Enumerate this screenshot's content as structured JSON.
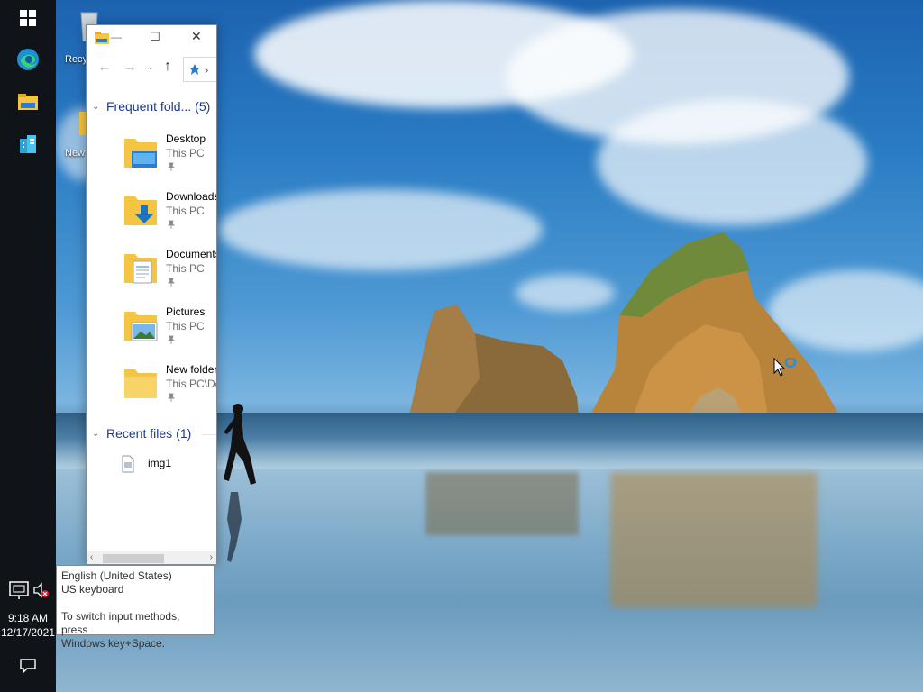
{
  "taskbar": {
    "start_icon": "windows-start-icon",
    "pinned": [
      {
        "icon": "edge-icon"
      },
      {
        "icon": "file-explorer-icon"
      },
      {
        "icon": "building-app-icon"
      }
    ],
    "tray": {
      "network_icon": "network-icon",
      "volume_icon": "volume-muted-icon"
    },
    "clock": {
      "time": "9:18 AM",
      "date": "12/17/2021"
    },
    "notification_icon": "action-center-icon"
  },
  "desktop": {
    "icons": [
      {
        "label": "Recy",
        "icon": "recycle-bin-icon"
      },
      {
        "label": "New",
        "icon": "folder-icon"
      }
    ]
  },
  "explorer": {
    "title_icon": "file-explorer-icon",
    "title_dash": "—",
    "controls": {
      "minimize": "—",
      "maximize": "☐",
      "close": "✕"
    },
    "address_sep": "›",
    "sections": {
      "frequent": {
        "label": "Frequent fold...",
        "count": "(5)"
      },
      "recent": {
        "label": "Recent files",
        "count": "(1)"
      }
    },
    "frequent_folders": [
      {
        "name": "Desktop",
        "location": "This PC",
        "icon": "desktop-folder-icon"
      },
      {
        "name": "Downloads",
        "location": "This PC",
        "icon": "downloads-folder-icon"
      },
      {
        "name": "Documents",
        "location": "This PC",
        "icon": "documents-folder-icon"
      },
      {
        "name": "Pictures",
        "location": "This PC",
        "icon": "pictures-folder-icon"
      },
      {
        "name": "New folder",
        "location": "This PC\\De",
        "icon": "folder-icon"
      }
    ],
    "recent_files": [
      {
        "name": "img1",
        "icon": "image-file-icon"
      }
    ]
  },
  "tooltip": {
    "line1": "English (United States)",
    "line2": "US keyboard",
    "line3": "To switch input methods, press",
    "line4": "Windows key+Space."
  },
  "colors": {
    "taskbar": "#101418",
    "section_header": "#1e3a8a",
    "folder_yellow": "#f5c542",
    "accent_blue": "#1e73be"
  }
}
